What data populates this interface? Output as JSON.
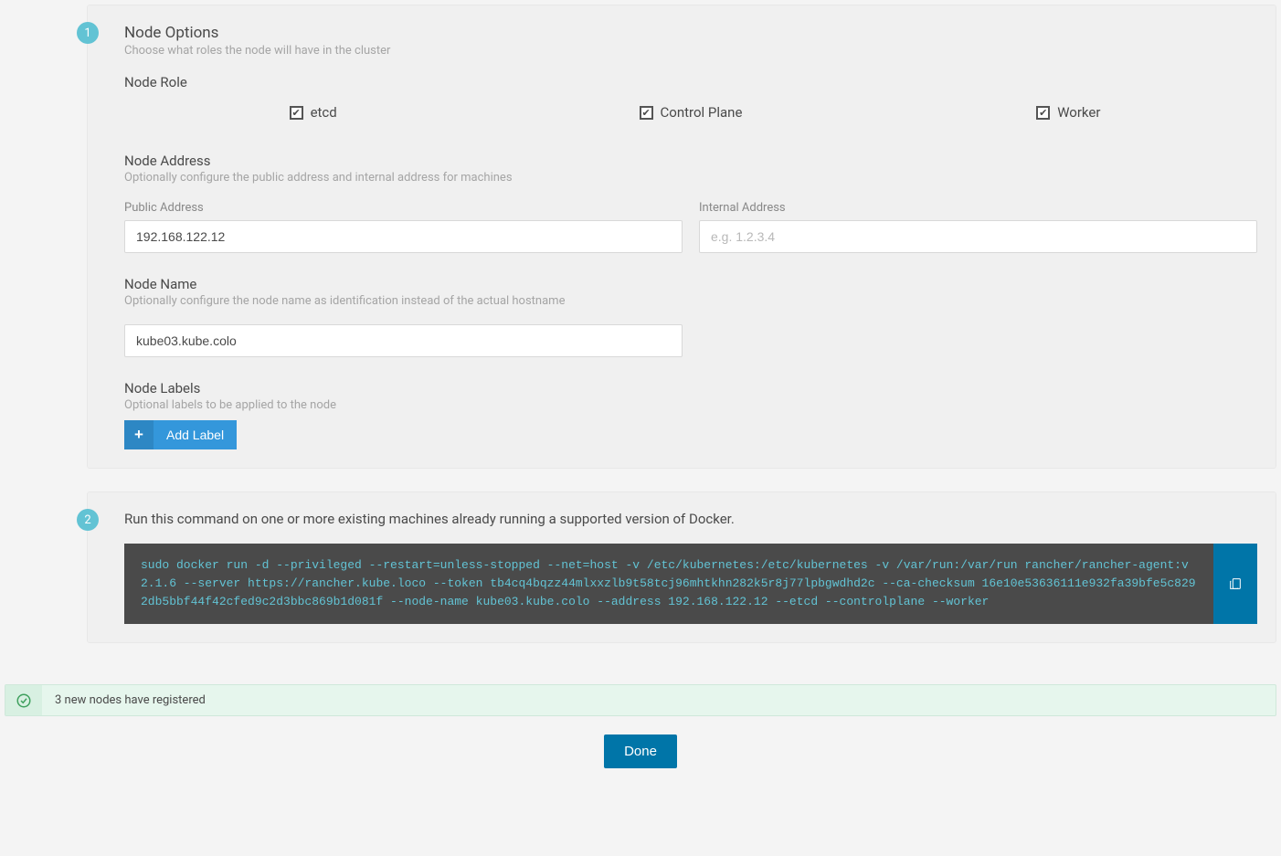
{
  "step1": {
    "badge": "1",
    "title": "Node Options",
    "desc": "Choose what roles the node will have in the cluster",
    "role": {
      "title": "Node Role",
      "etcd": "etcd",
      "control_plane": "Control Plane",
      "worker": "Worker"
    },
    "address": {
      "title": "Node Address",
      "desc": "Optionally configure the public address and internal address for machines",
      "public_label": "Public Address",
      "public_value": "192.168.122.12",
      "internal_label": "Internal Address",
      "internal_placeholder": "e.g. 1.2.3.4"
    },
    "name": {
      "title": "Node Name",
      "desc": "Optionally configure the node name as identification instead of the actual hostname",
      "value": "kube03.kube.colo"
    },
    "labels": {
      "title": "Node Labels",
      "desc": "Optional labels to be applied to the node",
      "add_btn": "Add Label"
    }
  },
  "step2": {
    "badge": "2",
    "desc": "Run this command on one or more existing machines already running a supported version of Docker.",
    "command": "sudo docker run -d --privileged --restart=unless-stopped --net=host -v /etc/kubernetes:/etc/kubernetes -v /var/run:/var/run rancher/rancher-agent:v2.1.6 --server https://rancher.kube.loco --token tb4cq4bqzz44mlxxzlb9t58tcj96mhtkhn282k5r8j77lpbgwdhd2c --ca-checksum 16e10e53636111e932fa39bfe5c8292db5bbf44f42cfed9c2d3bbc869b1d081f --node-name kube03.kube.colo --address 192.168.122.12 --etcd --controlplane --worker"
  },
  "notice": "3 new nodes have registered",
  "done": "Done"
}
